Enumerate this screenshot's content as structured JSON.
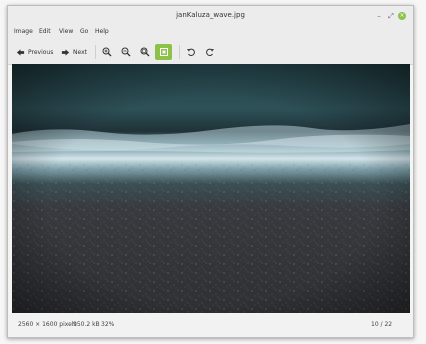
{
  "window": {
    "title": "janKaluza_wave.jpg",
    "controls": {
      "minimize": "–",
      "maximize": "⤢",
      "close": "×"
    }
  },
  "menu": [
    "Image",
    "Edit",
    "View",
    "Go",
    "Help"
  ],
  "toolbar": {
    "previous_label": "Previous",
    "next_label": "Next",
    "icons": [
      "zoom-in-icon",
      "zoom-out-icon",
      "zoom-normal-icon",
      "best-fit-icon",
      "rotate-left-icon",
      "rotate-right-icon"
    ]
  },
  "image": {
    "description_colors": {
      "sea_top": "#2b4b52",
      "wave_foam": "#cfe0e6",
      "sand": "#3a3b40"
    }
  },
  "status": {
    "dimensions": "2560 × 1600 pixels",
    "size": "950.2 kB",
    "zoom": "32%",
    "position": "10 / 22"
  },
  "colors": {
    "accent": "#8cc24a"
  }
}
